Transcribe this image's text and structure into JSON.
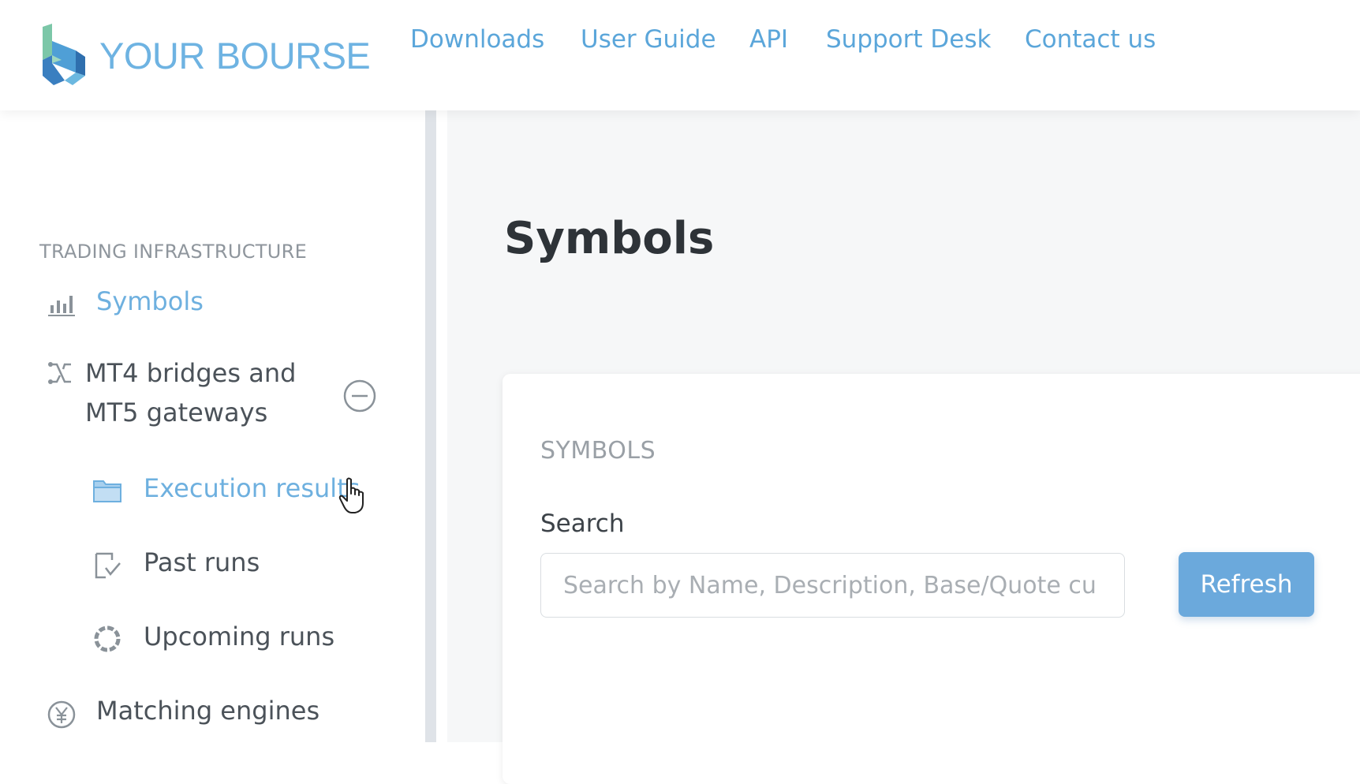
{
  "header": {
    "brand": {
      "word1": "YOUR",
      "word2": "BOURSE"
    },
    "nav": {
      "downloads": "Downloads",
      "user_guide": "User Guide",
      "api": "API",
      "support": "Support Desk",
      "contact": "Contact us"
    }
  },
  "sidebar": {
    "section_heading": "TRADING INFRASTRUCTURE",
    "items": {
      "symbols": {
        "label": "Symbols",
        "icon": "bar-chart-icon",
        "active": true
      },
      "mt4": {
        "label": "MT4 bridges and MT5 gateways",
        "icon": "bridge-icon",
        "expanded": true
      },
      "execution_results": {
        "label": "Execution results",
        "icon": "folder-icon",
        "active": true
      },
      "past_runs": {
        "label": "Past runs",
        "icon": "checklist-icon"
      },
      "upcoming_runs": {
        "label": "Upcoming runs",
        "icon": "loading-ring-icon"
      },
      "matching_engines": {
        "label": "Matching engines",
        "icon": "yen-coin-icon"
      }
    }
  },
  "main": {
    "title": "Symbols",
    "card": {
      "heading": "SYMBOLS",
      "search_label": "Search",
      "search_placeholder": "Search by Name, Description, Base/Quote cu",
      "search_value": "",
      "refresh_label": "Refresh"
    }
  },
  "colors": {
    "accent": "#6ba9dc",
    "nav_link": "#5ba6da",
    "sidebar_border": "#dfe3e8",
    "main_bg": "#f6f7f8"
  }
}
